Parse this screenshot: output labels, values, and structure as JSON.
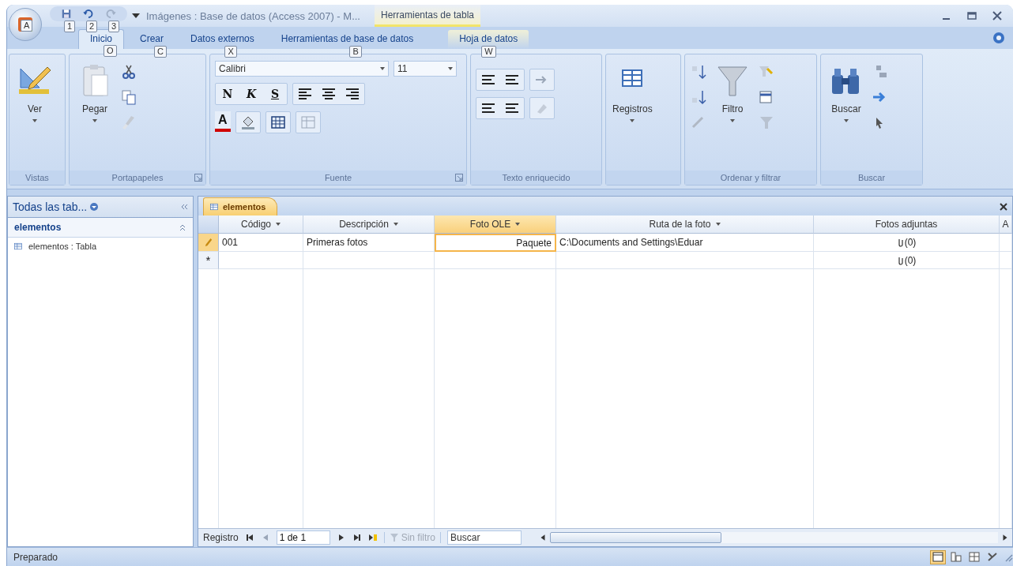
{
  "window": {
    "title": "Imágenes : Base de datos (Access 2007) - M...",
    "contextual_tab": "Herramientas de tabla"
  },
  "office_button": {
    "keytip": "A"
  },
  "quick_access": [
    {
      "kind": "save",
      "keytip": "1",
      "disabled": false
    },
    {
      "kind": "undo",
      "keytip": "2",
      "disabled": false
    },
    {
      "kind": "redo",
      "keytip": "3",
      "disabled": true
    }
  ],
  "tabs": [
    {
      "label": "Inicio",
      "keytip": "O",
      "selected": true,
      "contextual": false
    },
    {
      "label": "Crear",
      "keytip": "C",
      "selected": false,
      "contextual": false
    },
    {
      "label": "Datos externos",
      "keytip": "X",
      "selected": false,
      "contextual": false
    },
    {
      "label": "Herramientas de base de datos",
      "keytip": "B",
      "selected": false,
      "contextual": false
    },
    {
      "label": "Hoja de datos",
      "keytip": "W",
      "selected": false,
      "contextual": true
    }
  ],
  "ribbon": {
    "groups": [
      {
        "kind": "views",
        "label": "Vistas",
        "button": "Ver",
        "launcher": false
      },
      {
        "kind": "clipboard",
        "label": "Portapapeles",
        "button": "Pegar",
        "launcher": true
      },
      {
        "kind": "font",
        "label": "Fuente",
        "font": "Calibri",
        "size": "11",
        "styles": [
          "N",
          "K",
          "S"
        ],
        "color_button": "A",
        "launcher": true
      },
      {
        "kind": "rich_text",
        "label": "Texto enriquecido",
        "launcher": false
      },
      {
        "kind": "records",
        "button": "Registros",
        "launcher": false
      },
      {
        "kind": "sort_filter",
        "label": "Ordenar y filtrar",
        "button": "Filtro",
        "launcher": false
      },
      {
        "kind": "find",
        "label": "Buscar",
        "button": "Buscar",
        "launcher": false
      }
    ]
  },
  "navigation_pane": {
    "header": "Todas las tab...",
    "groups": [
      {
        "label": "elementos",
        "expanded": true,
        "items": [
          {
            "label": "elementos : Tabla",
            "selected": false
          }
        ]
      }
    ]
  },
  "document_tab": {
    "label": "elementos"
  },
  "datasheet": {
    "columns": [
      {
        "label": "Código",
        "dropdown": true,
        "selected": false
      },
      {
        "label": "Descripción",
        "dropdown": true,
        "selected": false
      },
      {
        "label": "Foto OLE",
        "dropdown": true,
        "selected": true
      },
      {
        "label": "Ruta de la foto",
        "dropdown": true,
        "selected": false
      },
      {
        "label": "Fotos adjuntas",
        "dropdown": false,
        "selected": false
      },
      {
        "label": "A",
        "dropdown": false,
        "selected": false
      }
    ],
    "rows": [
      {
        "kind": "record",
        "cells": [
          {
            "text": "001",
            "selected": false
          },
          {
            "text": "Primeras fotos",
            "selected": false
          },
          {
            "text": "Paquete",
            "selected": true,
            "kind": "ole"
          },
          {
            "text": "C:\\Documents and Settings\\Eduar",
            "selected": false
          },
          {
            "text": "(0)",
            "selected": false,
            "kind": "attachment"
          }
        ]
      },
      {
        "kind": "new",
        "marker": "*",
        "attachments": "(0)"
      }
    ]
  },
  "record_navigator": {
    "label": "Registro",
    "position": "1 de 1",
    "filter": {
      "label": "Sin filtro",
      "active": false
    },
    "search": {
      "placeholder": "Buscar"
    }
  },
  "status_bar": {
    "text": "Preparado",
    "views": [
      {
        "selected": true
      },
      {
        "selected": false
      },
      {
        "selected": false
      },
      {
        "selected": false
      }
    ]
  }
}
